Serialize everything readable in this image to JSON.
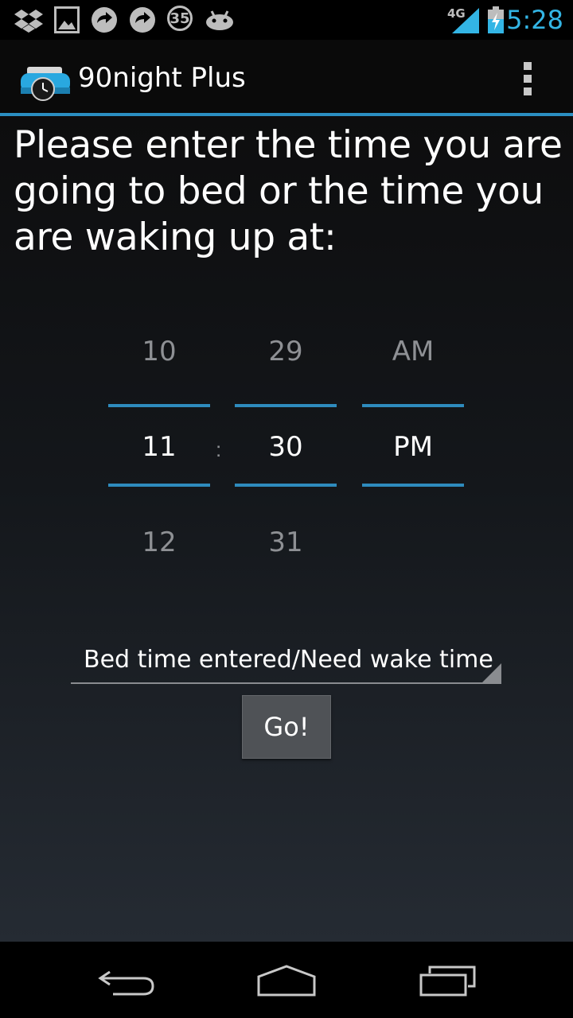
{
  "status_bar": {
    "time": "5:28",
    "network_type": "4G",
    "notification_badge": "35",
    "icons": [
      "dropbox-icon",
      "gallery-icon",
      "sync-icon",
      "sync-icon",
      "badge-35-icon",
      "android-icon",
      "signal-icon",
      "battery-charging-icon"
    ],
    "accent_color": "#33b5e5"
  },
  "action_bar": {
    "title": "90night Plus",
    "app_icon": "bed-clock-icon",
    "menu_icon": "overflow-menu-icon"
  },
  "main": {
    "instruction": "Please enter the time you are going to bed or the time you are waking up at:",
    "time_picker": {
      "separator": ":",
      "hour": {
        "prev": "10",
        "current": "11",
        "next": "12"
      },
      "minute": {
        "prev": "29",
        "current": "30",
        "next": "31"
      },
      "ampm": {
        "prev": "AM",
        "current": "PM",
        "next": ""
      }
    },
    "mode_spinner": {
      "selected": "Bed time entered/Need wake time"
    },
    "go_button": "Go!"
  },
  "nav_bar": {
    "buttons": [
      "back-icon",
      "home-icon",
      "recents-icon"
    ]
  }
}
